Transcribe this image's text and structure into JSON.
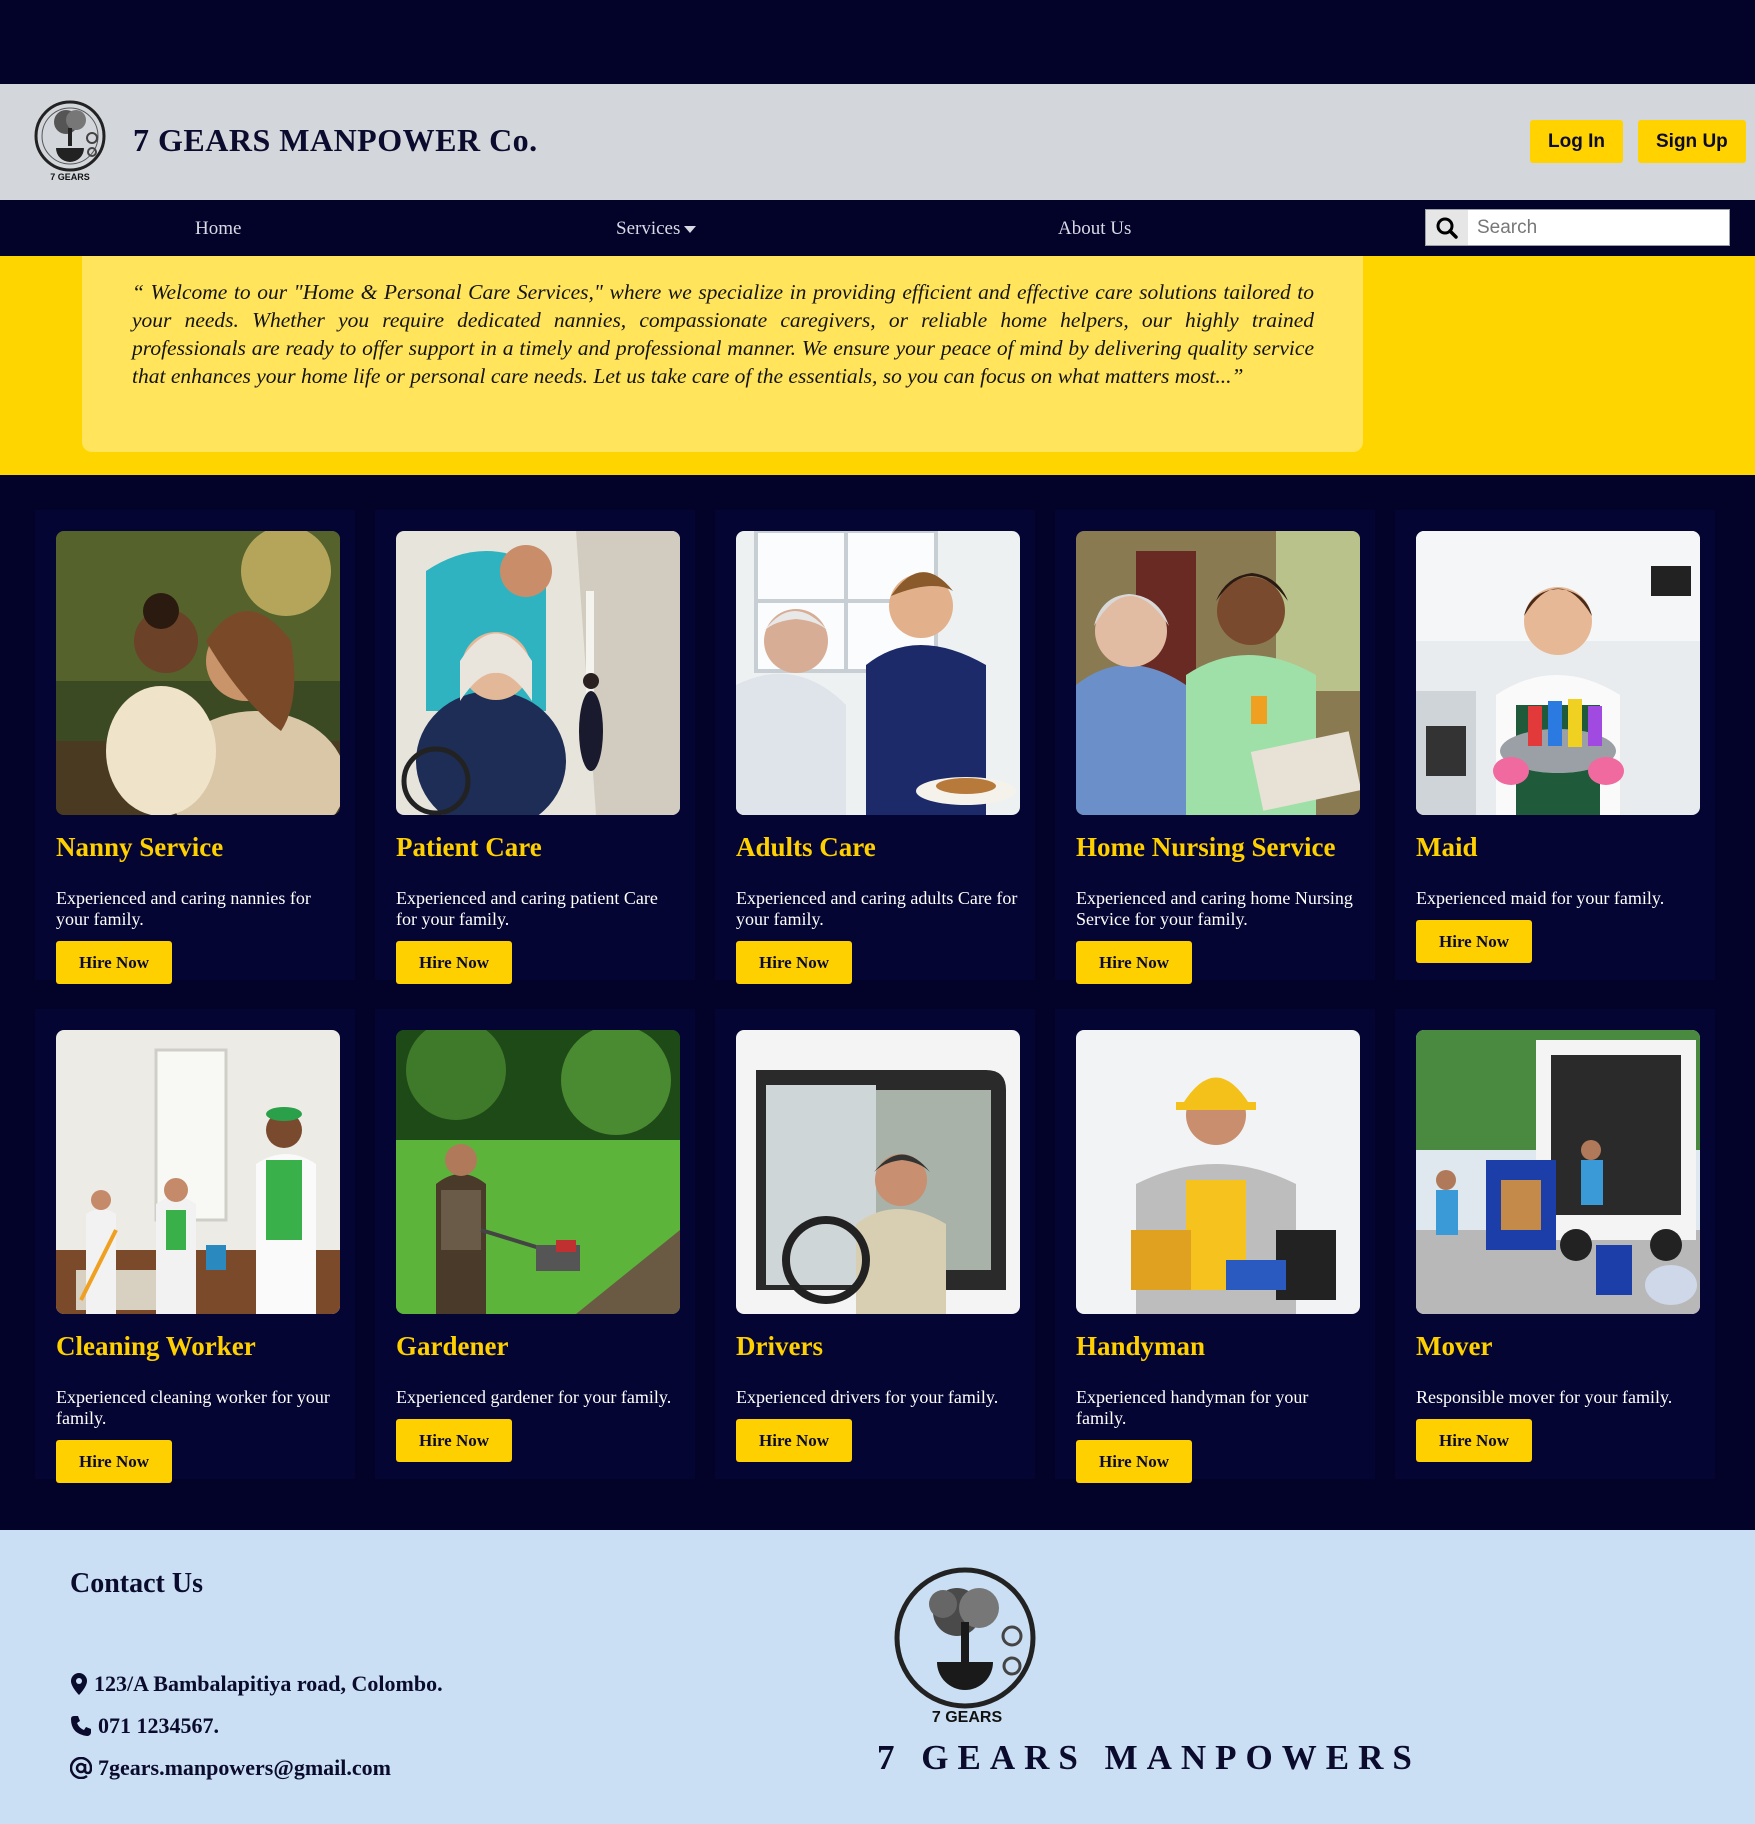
{
  "header": {
    "brand": "7 GEARS MANPOWER Co.",
    "logo_text": "7 GEARS",
    "login_label": "Log In",
    "signup_label": "Sign Up"
  },
  "nav": {
    "home": "Home",
    "services": "Services",
    "about": "About Us",
    "search_placeholder": "Search"
  },
  "intro": {
    "quote": "“ Welcome to our \"Home & Personal Care Services,\" where we specialize in providing efficient and effective care solutions tailored to your needs. Whether you require dedicated nannies, compassionate caregivers, or reliable home helpers, our highly trained professionals are ready to offer support in a timely and professional manner. We ensure your peace of mind by delivering quality service that enhances your home life or personal care needs. Let us take care of the essentials, so you can focus on what matters most...”"
  },
  "services": [
    {
      "title": "Nanny Service",
      "desc": "Experienced and caring nannies for your family.",
      "button": "Hire Now"
    },
    {
      "title": "Patient Care",
      "desc": "Experienced and caring patient Care for your family.",
      "button": "Hire Now"
    },
    {
      "title": "Adults Care",
      "desc": "Experienced and caring adults Care for your family.",
      "button": "Hire Now"
    },
    {
      "title": "Home Nursing Service",
      "desc": "Experienced and caring home Nursing Service for your family.",
      "button": "Hire Now"
    },
    {
      "title": "Maid",
      "desc": "Experienced maid for your family.",
      "button": "Hire Now"
    },
    {
      "title": "Cleaning Worker",
      "desc": "Experienced cleaning worker for your family.",
      "button": "Hire Now"
    },
    {
      "title": "Gardener",
      "desc": "Experienced gardener for your family.",
      "button": "Hire Now"
    },
    {
      "title": "Drivers",
      "desc": "Experienced drivers for your family.",
      "button": "Hire Now"
    },
    {
      "title": "Handyman",
      "desc": "Experienced handyman for your family.",
      "button": "Hire Now"
    },
    {
      "title": "Mover",
      "desc": "Responsible mover for your family.",
      "button": "Hire Now"
    }
  ],
  "footer": {
    "contact_title": "Contact Us",
    "address": "123/A Bambalapitiya road, Colombo.",
    "phone": "071 1234567.",
    "email": "7gears.manpowers@gmail.com",
    "brand": "7 GEARS MANPOWERS",
    "logo_text": "7 GEARS"
  },
  "colors": {
    "navy": "#03032a",
    "yellow": "#ffd500",
    "quote_bg": "#ffe45c",
    "footer_bg": "#cadff3",
    "header_bg": "#d3d6db"
  },
  "icons": [
    "search-icon",
    "caret-down-icon",
    "location-pin-icon",
    "phone-icon",
    "at-sign-icon",
    "gear-tree-logo"
  ]
}
